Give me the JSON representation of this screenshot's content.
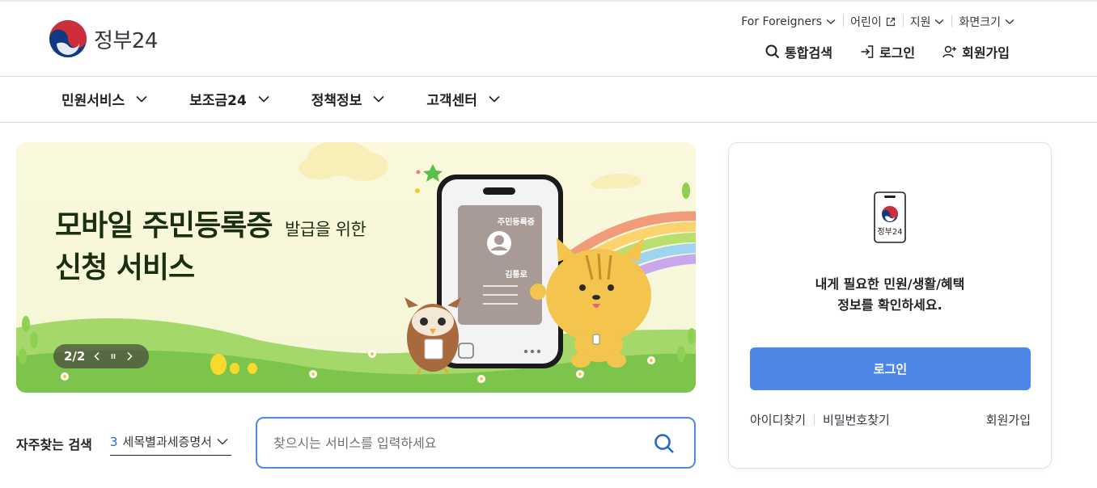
{
  "header": {
    "logo_text": "정부24",
    "util": {
      "foreigners": "For Foreigners",
      "kids": "어린이",
      "support": "지원",
      "font_size": "화면크기"
    },
    "actions": {
      "search": "통합검색",
      "login": "로그인",
      "signup": "회원가입"
    }
  },
  "gnb": {
    "items": [
      {
        "label": "민원서비스"
      },
      {
        "label": "보조금24"
      },
      {
        "label": "정책정보"
      },
      {
        "label": "고객센터"
      }
    ]
  },
  "banner": {
    "title_main": "모바일 주민등록증",
    "title_small": "발급을 위한",
    "title_line2": "신청 서비스",
    "card_title": "주민등록증",
    "card_name": "김통로",
    "pager": "2/2"
  },
  "quick_search": {
    "label": "자주찾는 검색",
    "selected_num": "3",
    "selected_text": "세목별과세증명서",
    "placeholder": "찾으시는 서비스를 입력하세요"
  },
  "login_card": {
    "logo_label": "정부24",
    "message_line1": "내게 필요한 민원/생활/혜택",
    "message_line2": "정보를 확인하세요.",
    "login_button": "로그인",
    "find_id": "아이디찾기",
    "find_pw": "비밀번호찾기",
    "signup": "회원가입"
  },
  "colors": {
    "accent_blue": "#4c86e6",
    "search_border": "#4e8ae6",
    "taeguk_red": "#cd2e3a",
    "taeguk_blue": "#0f3a82"
  }
}
